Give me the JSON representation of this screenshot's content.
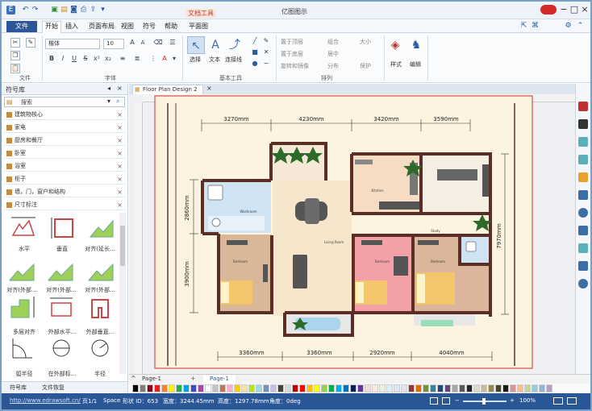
{
  "title_bar": {
    "app_title": "亿图图示",
    "doc_tools_tab": "文档工具"
  },
  "menu": {
    "file": "文件",
    "items": [
      "开始",
      "插入",
      "页面布局",
      "视图",
      "符号",
      "帮助",
      "平面图"
    ]
  },
  "ribbon": {
    "font_name": "楷体",
    "font_size": "10",
    "group_font": "字体",
    "select_label": "选择",
    "text_label": "文本",
    "connector_label": "连接线",
    "group_basic_tools": "基本工具",
    "arrange_items": [
      "置于顶层",
      "置于底层",
      "旋转和镜像",
      "组合",
      "居中",
      "分布",
      "大小",
      "保护"
    ],
    "group_arrange": "排列",
    "style_label": "样式",
    "edit_label": "编辑"
  },
  "left_panel": {
    "title": "符号库",
    "search_placeholder": "搜索",
    "libraries": [
      "建筑物核心",
      "家电",
      "厨房和餐厅",
      "卧室",
      "浴室",
      "柜子",
      "墙，门，窗户和结构",
      "尺寸标注"
    ],
    "symbols": [
      "水平",
      "垂直",
      "对齐(延长...",
      "对齐(外部...",
      "对齐(外部...",
      "对齐(外部...",
      "多层对齐",
      "外部水平...",
      "外部垂直...",
      "弧半径",
      "在外部标...",
      "半径"
    ],
    "bottom_tabs": [
      "符号库",
      "文件恢复"
    ]
  },
  "canvas": {
    "tab_title": "Floor Plan Design 2",
    "dims_top": [
      "3270mm",
      "4230mm",
      "3420mm",
      "3590mm"
    ],
    "dims_bottom": [
      "3360mm",
      "3360mm",
      "2920mm",
      "4040mm"
    ],
    "dims_left": [
      "2860mm",
      "3900mm"
    ],
    "dims_right": [
      "7970mm"
    ],
    "room_labels": [
      "Washroom",
      "Kitchen",
      "Study",
      "Living Room",
      "Bedroom",
      "Bedroom",
      "Bedroom"
    ]
  },
  "page_bar": {
    "tab1": "Page-1",
    "tab2": "Page-1"
  },
  "status_bar": {
    "url": "http://www.edrawsoft.cn/",
    "page": "页1/1",
    "space": "Space",
    "shape_id": "形状 ID：653",
    "width": "宽度：3244.45mm",
    "height": "高度：1297.78mm",
    "angle": "角度：0deg",
    "zoom": "100%"
  },
  "palette": [
    "#000000",
    "#7f7f7f",
    "#880015",
    "#ed1c24",
    "#ff7f27",
    "#fff200",
    "#22b14c",
    "#00a2e8",
    "#3f48cc",
    "#a349a4",
    "#ffffff",
    "#c3c3c3",
    "#b97a57",
    "#ffaec9",
    "#ffc90e",
    "#efe4b0",
    "#b5e61d",
    "#99d9ea",
    "#7092be",
    "#c8bfe7",
    "#404040",
    "#d9d9d9",
    "#c00000",
    "#ff0000",
    "#ffc000",
    "#ffff00",
    "#92d050",
    "#00b050",
    "#00b0f0",
    "#0070c0",
    "#002060",
    "#7030a0",
    "#f2dcdb",
    "#fde9d9",
    "#ebf1de",
    "#dbeef3",
    "#dce6f1",
    "#e4dfec",
    "#963634",
    "#e26b0a",
    "#76933c",
    "#31859c",
    "#1f497d",
    "#60497a",
    "#a6a6a6",
    "#595959",
    "#262626",
    "#ddd9c4",
    "#c4bd97",
    "#948a54",
    "#494529",
    "#1d1b10",
    "#d99694",
    "#fabf8f",
    "#c4d79b",
    "#92cddc",
    "#95b3d7",
    "#b1a0c7"
  ]
}
